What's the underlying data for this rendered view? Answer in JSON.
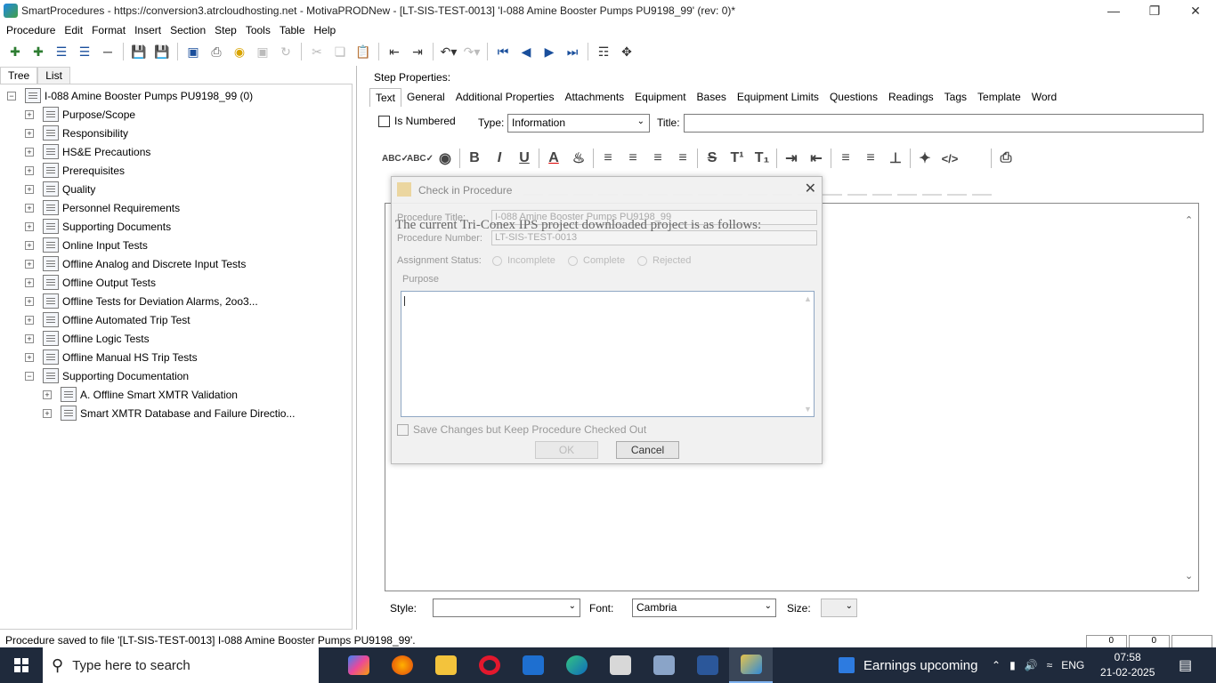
{
  "window": {
    "title": "SmartProcedures - https://conversion3.atrcloudhosting.net - MotivaPRODNew - [LT-SIS-TEST-0013] 'I-088 Amine Booster Pumps PU9198_99' (rev: 0)*",
    "min_icon": "minimize-icon",
    "max_icon": "restore-icon",
    "close_icon": "close-icon"
  },
  "menu": [
    "Procedure",
    "Edit",
    "Format",
    "Insert",
    "Section",
    "Step",
    "Tools",
    "Table",
    "Help"
  ],
  "left_tabs": [
    "Tree",
    "List"
  ],
  "tree": {
    "root": "I-088 Amine Booster Pumps PU9198_99 (0)",
    "items": [
      "Purpose/Scope",
      "Responsibility",
      "HS&E Precautions",
      "Prerequisites",
      "Quality",
      "Personnel Requirements",
      "Supporting Documents",
      "Online Input Tests",
      "Offline Analog and Discrete Input Tests",
      "Offline Output Tests",
      "Offline Tests for Deviation Alarms, 2oo3...",
      "Offline Automated Trip Test",
      "Offline Logic Tests",
      "Offline Manual HS Trip Tests",
      "Supporting Documentation"
    ],
    "children": [
      "A. Offline Smart XMTR Validation",
      "Smart XMTR Database and Failure Directio..."
    ]
  },
  "step_properties": {
    "label": "Step Properties:",
    "tabs": [
      "Text",
      "General",
      "Additional Properties",
      "Attachments",
      "Equipment",
      "Bases",
      "Equipment Limits",
      "Questions",
      "Readings",
      "Tags",
      "Template",
      "Word"
    ],
    "is_numbered": "Is Numbered",
    "type_label": "Type:",
    "type_value": "Information",
    "title_label": "Title:",
    "title_value": ""
  },
  "format_bar": {
    "bold": "B",
    "italic": "I",
    "underline": "U",
    "strike": "S",
    "super": "T¹",
    "sub": "T₁"
  },
  "bottom": {
    "style_label": "Style:",
    "style_value": "",
    "font_label": "Font:",
    "font_value": "Cambria",
    "size_label": "Size:",
    "size_value": ""
  },
  "status": {
    "text": "Procedure saved to file '[LT-SIS-TEST-0013] I-088 Amine Booster Pumps PU9198_99'.",
    "panel1": "0",
    "panel2": "0"
  },
  "dialog": {
    "title": "Check in Procedure",
    "proc_title_label": "Procedure Title:",
    "proc_title_value": "I-088 Amine Booster Pumps PU9198_99",
    "proc_number_label": "Procedure Number:",
    "proc_number_value": "LT-SIS-TEST-0013",
    "overlay_text": "The current Tri-Conex IPS project downloaded project is as follows:",
    "assignment_label": "Assignment Status:",
    "radios": [
      "Incomplete",
      "Complete",
      "Rejected"
    ],
    "purpose_label": "Purpose",
    "keep_label": "Save Changes but Keep Procedure Checked Out",
    "ok": "OK",
    "cancel": "Cancel"
  },
  "taskbar": {
    "search_placeholder": "Type here to search",
    "news": "Earnings upcoming",
    "lang": "ENG",
    "time": "07:58",
    "date": "21-02-2025"
  }
}
